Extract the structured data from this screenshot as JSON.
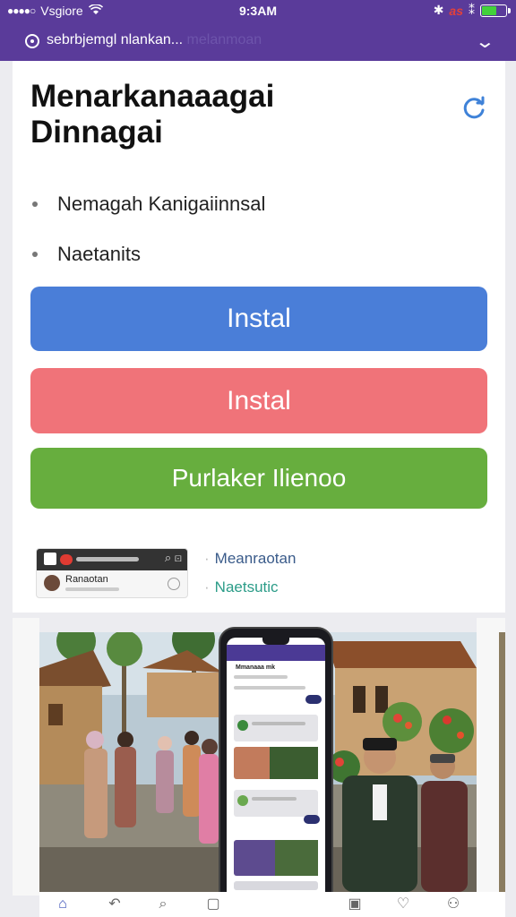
{
  "status_bar": {
    "carrier": "Vsgiore",
    "time": "9:3AM",
    "network": "as",
    "battery_level": 0.6,
    "battery_color": "#43d13b"
  },
  "url_bar": {
    "url": "sebrbjemgl nlankan...",
    "url_faded": "melanmoan"
  },
  "header": {
    "title": "Menarkanaaagai Dinnagai"
  },
  "features": {
    "items": [
      {
        "label": "Nemagah Kanigaiinnsal"
      },
      {
        "label": "Naetanits"
      }
    ]
  },
  "actions": {
    "primary_install": {
      "label": "Instal",
      "color": "#4a7ed8"
    },
    "secondary_install": {
      "label": "Instal",
      "color": "#f07379"
    },
    "tertiary": {
      "label": "Purlaker Ilienoo",
      "color": "#67ae3e"
    }
  },
  "preview": {
    "mini_label": "Ranaotan",
    "links": [
      {
        "label": "Meanraotan",
        "color": "#3a5b8a"
      },
      {
        "label": "Naetsutic",
        "color": "#2b9c88"
      }
    ]
  },
  "phone": {
    "title": "Mmanaaa mk"
  },
  "bottom_nav": {
    "items": [
      "home-icon",
      "undo-icon",
      "search-icon",
      "bookmark-icon",
      "document-icon",
      "heart-icon",
      "profile-icon"
    ]
  }
}
